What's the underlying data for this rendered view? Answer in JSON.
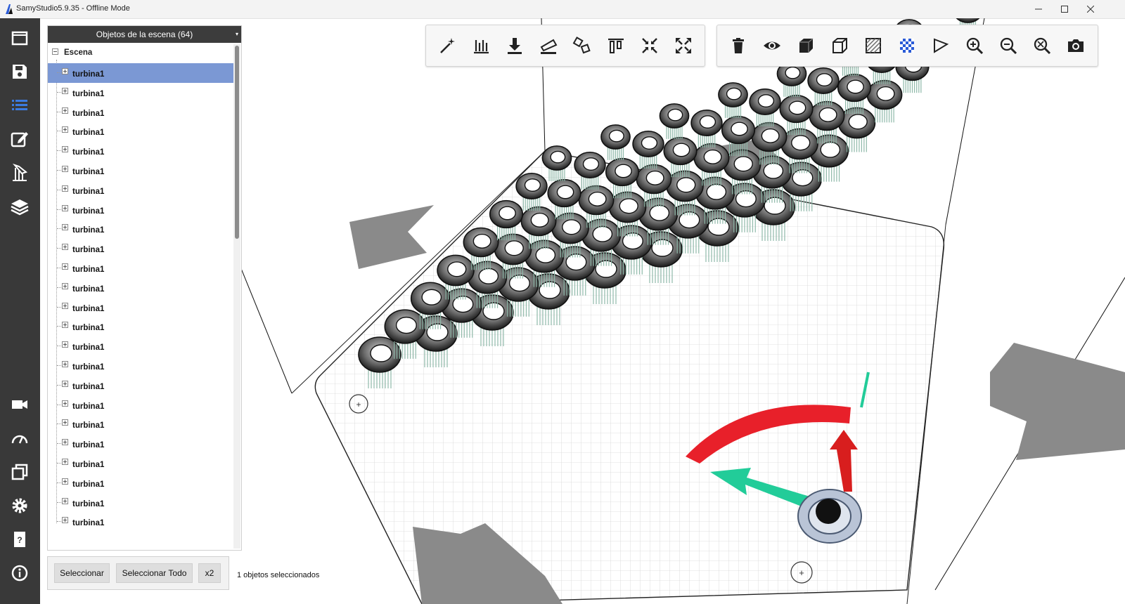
{
  "window": {
    "title": "SamyStudio5.9.35 - Offline Mode",
    "controls": [
      "minimize-icon",
      "maximize-icon",
      "close-icon"
    ]
  },
  "sidebar": {
    "icons": [
      "window-icon",
      "save-icon",
      "list-icon",
      "edit-icon",
      "support-icon",
      "layers-icon",
      "camera-icon",
      "gauge-icon",
      "copy-icon",
      "settings-icon",
      "help-icon",
      "info-icon"
    ]
  },
  "scene_panel": {
    "title": "Objetos de la escena (64)",
    "root_label": "Escena",
    "items": [
      "turbina1",
      "turbina1",
      "turbina1",
      "turbina1",
      "turbina1",
      "turbina1",
      "turbina1",
      "turbina1",
      "turbina1",
      "turbina1",
      "turbina1",
      "turbina1",
      "turbina1",
      "turbina1",
      "turbina1",
      "turbina1",
      "turbina1",
      "turbina1",
      "turbina1",
      "turbina1",
      "turbina1",
      "turbina1",
      "turbina1",
      "turbina1"
    ],
    "selected_index": 0
  },
  "buttons": {
    "select": "Seleccionar",
    "select_all": "Seleccionar Todo",
    "duplicate": "x2"
  },
  "status": {
    "selection_text": "1 objetos seleccionados"
  },
  "toolbar_left": {
    "icons": [
      "magic-wand-icon",
      "supports-icon",
      "drop-to-plate-icon",
      "orient-icon",
      "auto-rotate-icon",
      "align-icon",
      "shrink-icon",
      "expand-icon"
    ]
  },
  "toolbar_right": {
    "icons": [
      "delete-icon",
      "eye-icon",
      "solid-cube-icon",
      "wire-cube-icon",
      "hatch-icon",
      "checker-icon",
      "flag-icon",
      "zoom-in-icon",
      "zoom-out-icon",
      "zoom-fit-icon",
      "screenshot-icon"
    ]
  },
  "colors": {
    "sidebar_bg": "#393939",
    "selected_row": "#7b98d4",
    "gizmo_red": "#e8202a",
    "gizmo_green": "#22cc99"
  }
}
